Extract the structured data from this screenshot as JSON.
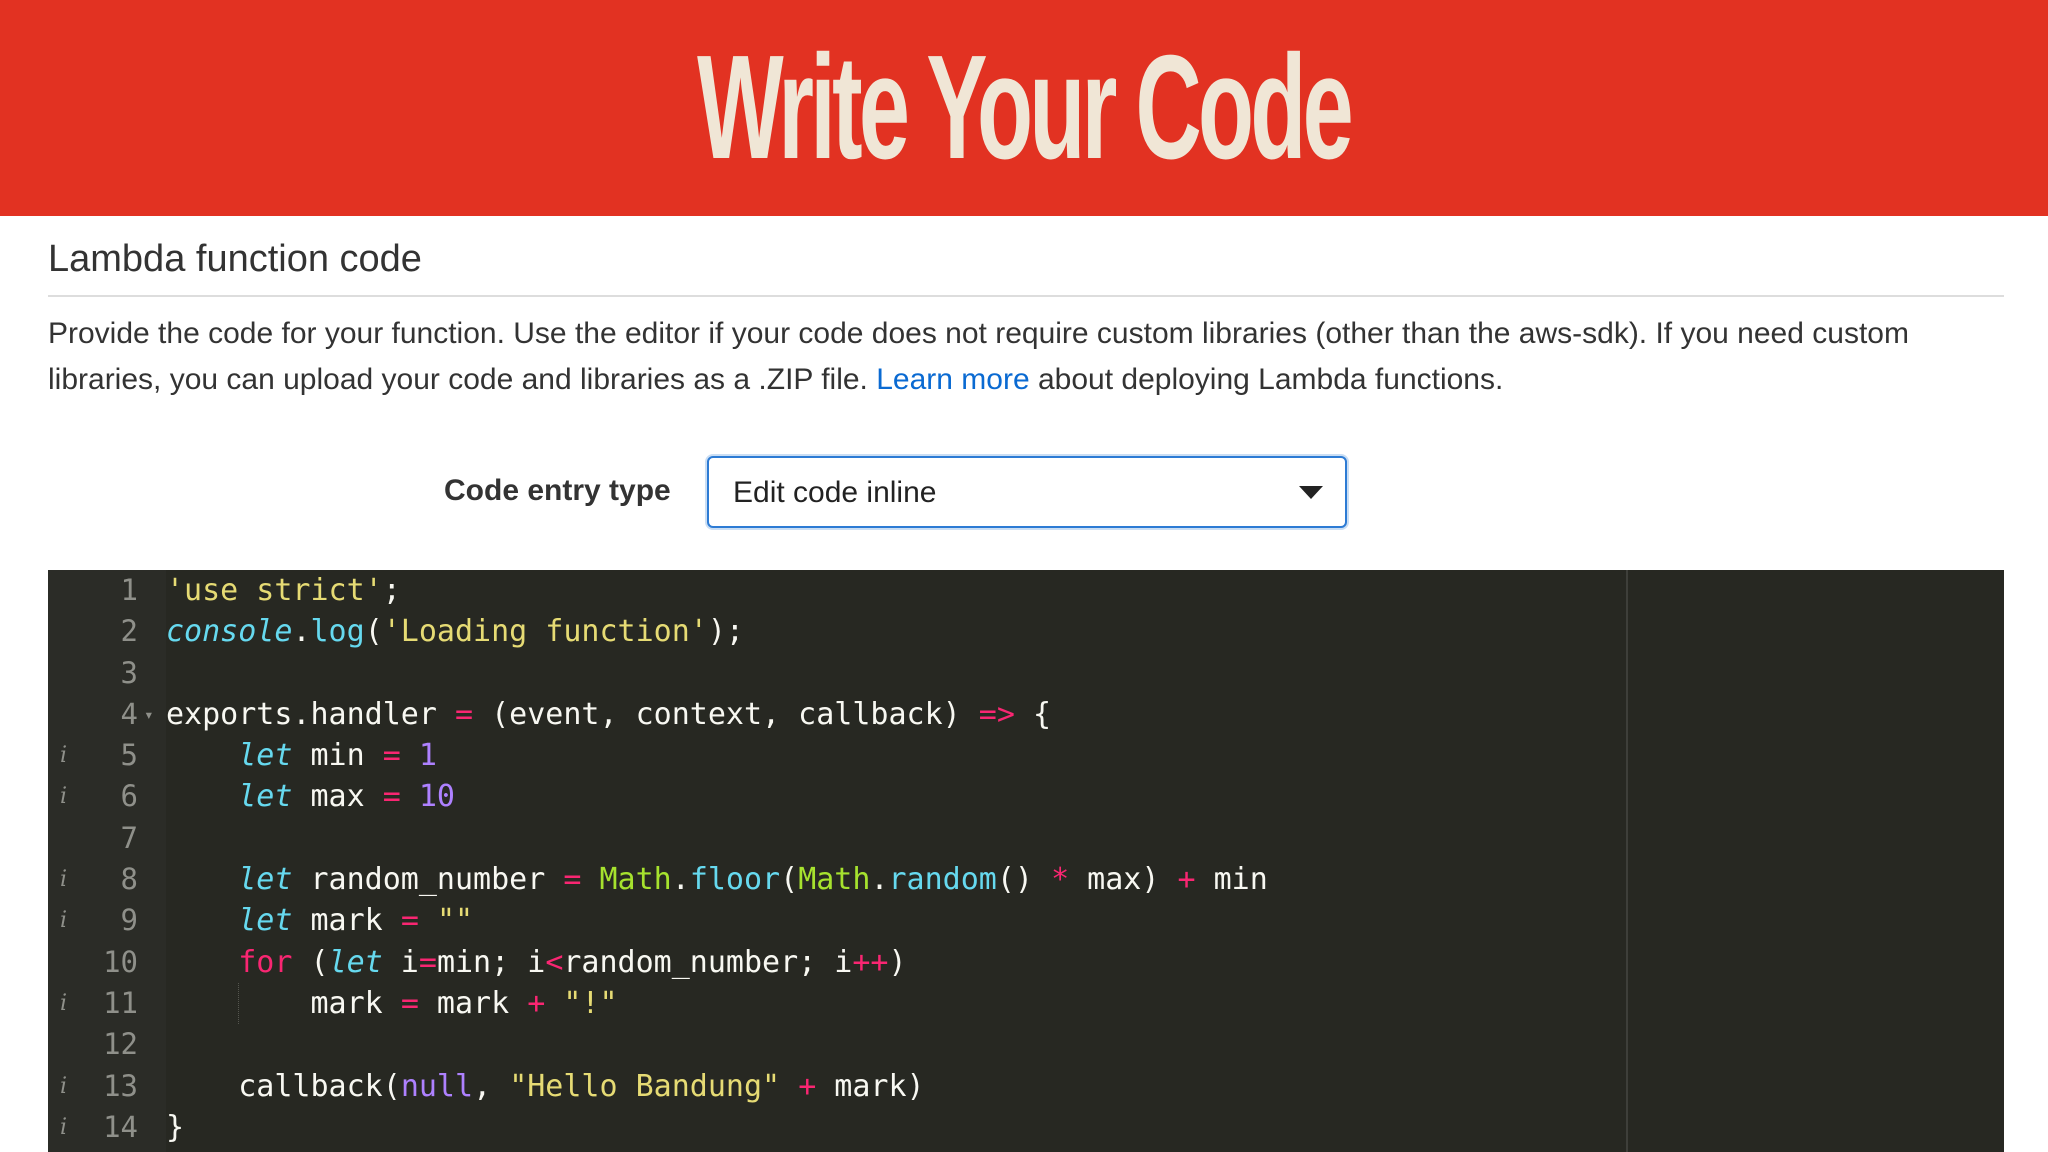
{
  "banner": {
    "title": "Write Your Code"
  },
  "section": {
    "title": "Lambda function code",
    "description_part1": "Provide the code for your function. Use the editor if your code does not require custom libraries (other than the aws-sdk). If you need custom libraries, you can upload your code and libraries as a .ZIP file. ",
    "learn_more_label": "Learn more",
    "description_part2": " about deploying Lambda functions."
  },
  "code_entry": {
    "label": "Code entry type",
    "selected": "Edit code inline"
  },
  "editor": {
    "language": "javascript",
    "info_marker": "i",
    "lines": [
      {
        "num": "1",
        "info": false,
        "fold": false,
        "text": "'use strict';"
      },
      {
        "num": "2",
        "info": false,
        "fold": false,
        "text": "console.log('Loading function');"
      },
      {
        "num": "3",
        "info": false,
        "fold": false,
        "text": ""
      },
      {
        "num": "4",
        "info": false,
        "fold": true,
        "text": "exports.handler = (event, context, callback) => {"
      },
      {
        "num": "5",
        "info": true,
        "fold": false,
        "text": "    let min = 1"
      },
      {
        "num": "6",
        "info": true,
        "fold": false,
        "text": "    let max = 10"
      },
      {
        "num": "7",
        "info": false,
        "fold": false,
        "text": ""
      },
      {
        "num": "8",
        "info": true,
        "fold": false,
        "text": "    let random_number = Math.floor(Math.random() * max) + min"
      },
      {
        "num": "9",
        "info": true,
        "fold": false,
        "text": "    let mark = \"\""
      },
      {
        "num": "10",
        "info": false,
        "fold": false,
        "text": "    for (let i=min; i<random_number; i++)"
      },
      {
        "num": "11",
        "info": true,
        "fold": false,
        "text": "        mark = mark + \"!\""
      },
      {
        "num": "12",
        "info": false,
        "fold": false,
        "text": ""
      },
      {
        "num": "13",
        "info": true,
        "fold": false,
        "text": "    callback(null, \"Hello Bandung\" + mark)"
      },
      {
        "num": "14",
        "info": true,
        "fold": false,
        "text": "}"
      }
    ]
  },
  "colors": {
    "banner_bg": "#e23222",
    "banner_text": "#f0e6d6",
    "link": "#0a6ad2",
    "select_border": "#2d7bd4",
    "editor_bg": "#272822"
  }
}
